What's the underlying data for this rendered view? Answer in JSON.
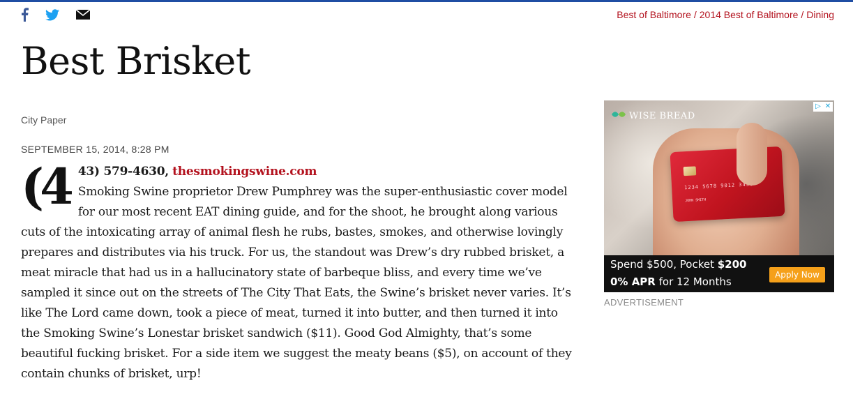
{
  "colors": {
    "accent": "#1f4ea3",
    "link": "#b3121e",
    "facebook": "#3b5998",
    "twitter": "#1da1f2",
    "apply_button": "#f5a01a"
  },
  "social": [
    {
      "name": "facebook",
      "icon": "facebook-icon"
    },
    {
      "name": "twitter",
      "icon": "twitter-icon"
    },
    {
      "name": "email",
      "icon": "envelope-icon"
    }
  ],
  "breadcrumb": {
    "items": [
      "Best of Baltimore",
      "2014 Best of Baltimore",
      "Dining"
    ],
    "separator": "/"
  },
  "article": {
    "title": "Best Brisket",
    "author": "City Paper",
    "dateline": "SEPTEMBER 15, 2014, 8:28 PM",
    "dropcap": "(4",
    "lead_phone": "43) 579-4630,",
    "lead_link": "thesmokingswine.com",
    "body": "Smoking Swine proprietor Drew Pumphrey was the super-enthusiastic cover model for our most recent EAT dining guide, and for the shoot, he brought along various cuts of the intoxicating array of animal flesh he rubs, bastes, smokes, and otherwise lovingly prepares and distributes via his truck. For us, the standout was Drew’s dry rubbed brisket, a meat miracle that had us in a hallucinatory state of barbeque bliss, and every time we’ve sampled it since out on the streets of The City That Eats, the Swine’s brisket never varies. It’s like The Lord came down, took a piece of meat, turned it into butter, and then turned it into the Smoking Swine’s Lonestar brisket sandwich ($11). Good God Almighty, that’s some beautiful fucking brisket. For a side item we suggest the meaty beans ($5), on account of they contain chunks of brisket, urp!"
  },
  "ad": {
    "brand": "WISE BREAD",
    "brand_icon": "leaf-logo-icon",
    "card_number": "1234 5678 9012 3456",
    "card_name": "JOHN SMITH",
    "offer_line1_prefix": "Spend $500, Pocket ",
    "offer_line1_amount": "$200",
    "offer_line2_bold": "0% APR",
    "offer_line2_rest": " for 12 Months",
    "cta": "Apply Now",
    "label": "ADVERTISEMENT",
    "adchoices_icon": "adchoices-icon",
    "close_icon": "close-icon"
  }
}
